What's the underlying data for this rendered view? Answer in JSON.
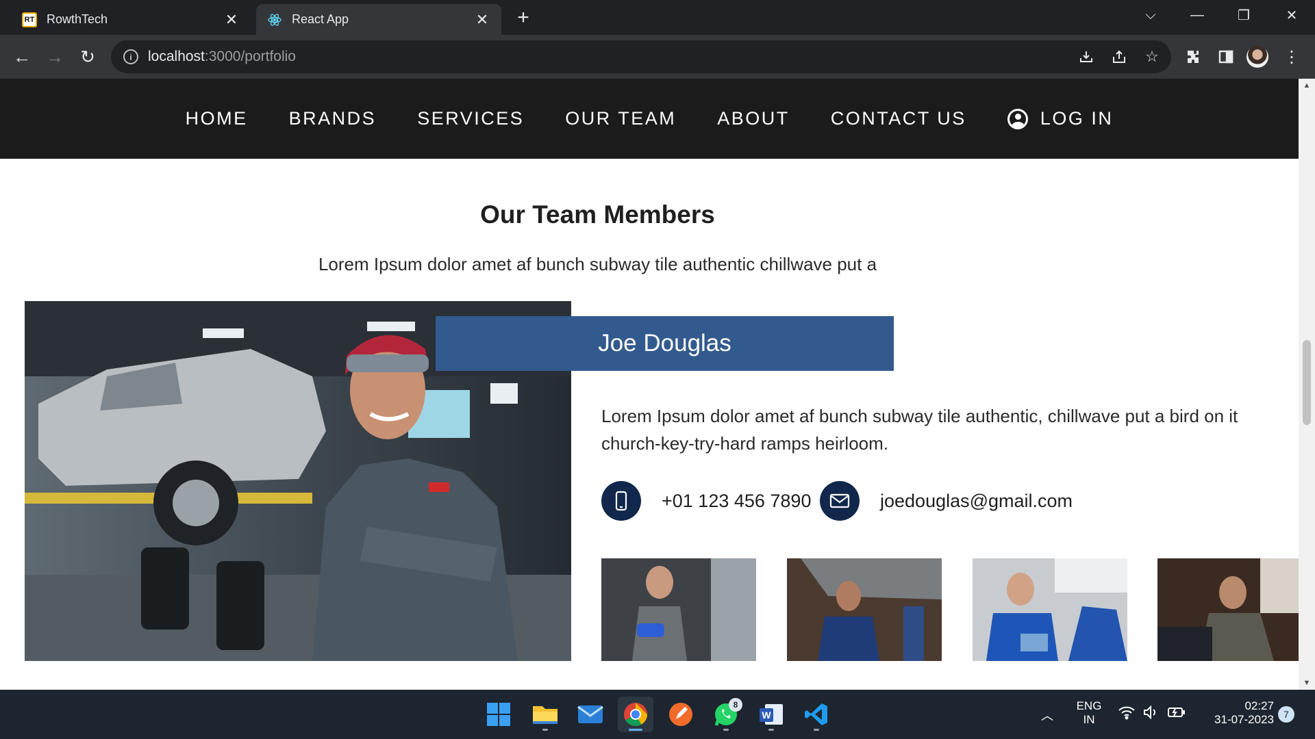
{
  "browser": {
    "tabs": [
      {
        "title": "RowthTech",
        "favicon": "RT"
      },
      {
        "title": "React App",
        "favicon": "react-icon"
      }
    ],
    "url_host": "localhost",
    "url_path": ":3000/portfolio"
  },
  "nav": {
    "items": [
      "HOME",
      "BRANDS",
      "SERVICES",
      "OUR TEAM",
      "ABOUT",
      "CONTACT US"
    ],
    "login": "LOG IN"
  },
  "team": {
    "title": "Our Team Members",
    "subtitle": "Lorem Ipsum dolor amet af bunch subway tile authentic chillwave put a",
    "member": {
      "name": "Joe Douglas",
      "bio": "Lorem Ipsum dolor amet af bunch subway tile authentic, chillwave put a bird on it church-key-try-hard ramps heirloom.",
      "phone": "+01 123 456 7890",
      "email": "joedouglas@gmail.com"
    }
  },
  "taskbar": {
    "whatsapp_badge": "8",
    "lang_line1": "ENG",
    "lang_line2": "IN",
    "time": "02:27",
    "date": "31-07-2023",
    "notifications": "7"
  },
  "colors": {
    "nav_bg": "#1b1b1b",
    "banner": "#335a8e",
    "icon_circle": "#11284c"
  }
}
